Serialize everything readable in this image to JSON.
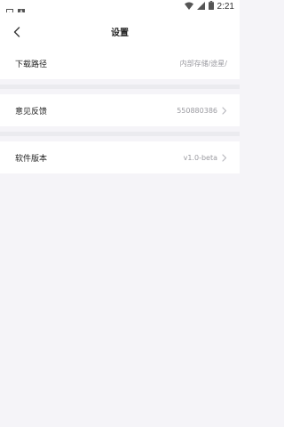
{
  "status_bar": {
    "time": "2:21",
    "icons": [
      "image-icon",
      "a-icon",
      "wifi-icon",
      "signal-icon",
      "battery-icon"
    ]
  },
  "header": {
    "title": "设置",
    "back_icon": "back-arrow-icon"
  },
  "settings": [
    {
      "label": "下载路径",
      "value": "内部存储/途星/",
      "has_chevron": false
    },
    {
      "label": "意见反馈",
      "value": "550880386",
      "has_chevron": true
    },
    {
      "label": "软件版本",
      "value": "v1.0-beta",
      "has_chevron": true
    }
  ],
  "colors": {
    "page_bg": "#f5f4f8",
    "row_bg": "#ffffff",
    "divider": "#ebebef",
    "value_text": "#9a9aa0"
  }
}
